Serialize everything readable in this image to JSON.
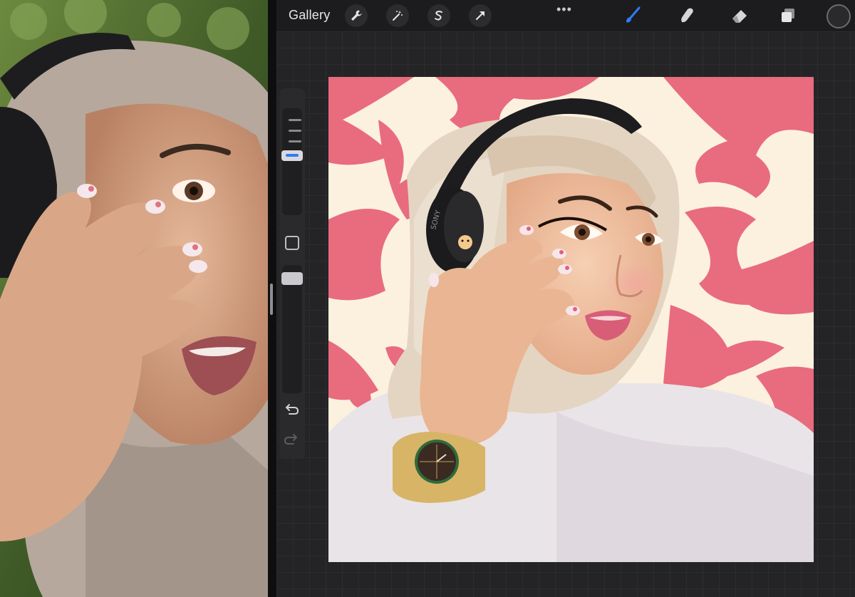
{
  "toolbar": {
    "gallery_label": "Gallery",
    "actions_icon": "wrench-icon",
    "adjustments_icon": "magic-wand-icon",
    "selection_icon": "selection-s-icon",
    "transform_icon": "arrow-cursor-icon",
    "more_label": "•••",
    "brush_icon": "brush-icon",
    "smudge_icon": "smudge-icon",
    "eraser_icon": "eraser-icon",
    "layers_icon": "layers-icon",
    "active_tool_color": "#2f7cf6",
    "current_color": "#2a2a2c"
  },
  "sidebar": {
    "brush_size_level": 0.6,
    "opacity_level": 0.95,
    "undo_icon": "undo-icon",
    "redo_icon": "redo-icon"
  },
  "reference": {
    "icon": "photo-reference"
  },
  "artwork": {
    "headphone_brand": "SONY",
    "palette": {
      "background": "#fbf1de",
      "swirl": "#e96b7e",
      "hijab": "#e4d5c2",
      "skin": "#f2c3a4",
      "shirt": "#e9e4e8",
      "headphones": "#1d1d1f",
      "watch": "#d8b467"
    }
  }
}
